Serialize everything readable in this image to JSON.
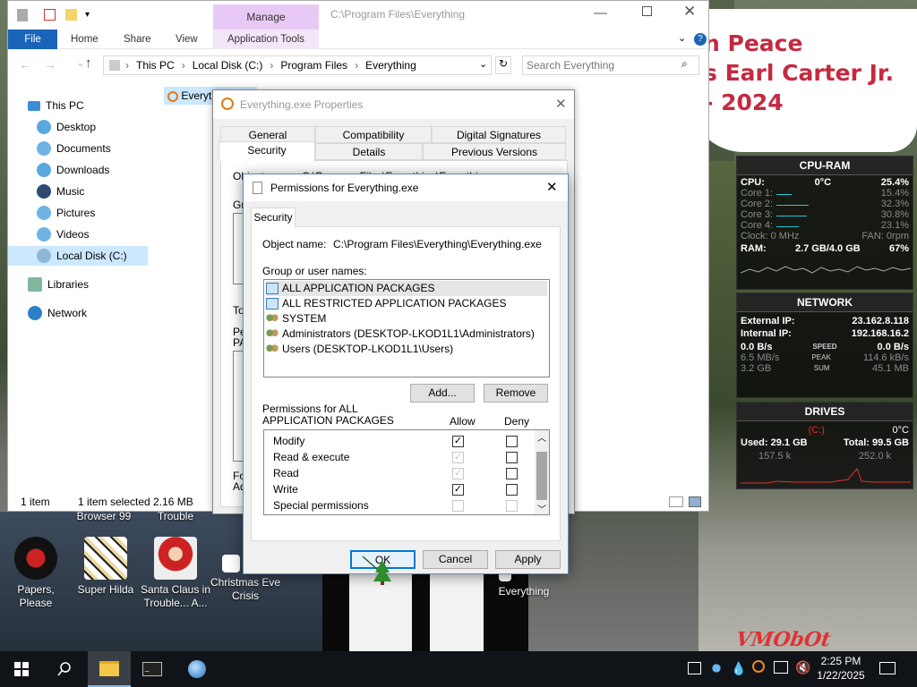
{
  "explorer": {
    "window_title": "C:\\Program Files\\Everything",
    "context_tab": "Manage",
    "tabs": [
      "File",
      "Home",
      "Share",
      "View",
      "Application Tools"
    ],
    "breadcrumb": [
      "This PC",
      "Local Disk (C:)",
      "Program Files",
      "Everything"
    ],
    "search_placeholder": "Search Everything",
    "file_item": "Everything",
    "nav": [
      "This PC",
      "Desktop",
      "Documents",
      "Downloads",
      "Music",
      "Pictures",
      "Videos",
      "Local Disk (C:)",
      "Libraries",
      "Network"
    ],
    "status": {
      "count": "1 item",
      "selected": "1 item selected  2.16 MB"
    }
  },
  "props": {
    "title": "Everything.exe Properties",
    "tabs_row1": [
      "General",
      "Compatibility",
      "Digital Signatures"
    ],
    "tabs_row2": [
      "Security",
      "Details",
      "Previous Versions"
    ],
    "obj_label_partial": "Object name:",
    "obj_value_partial": "C:\\Program Files\\Everything\\Everything.exe",
    "frag_gr": "Gr",
    "frag_to": "To",
    "frag_pe": "Pe",
    "frag_pa": "PA",
    "frag_fo": "Fo",
    "frag_ad": "Ad"
  },
  "perm": {
    "title": "Permissions for Everything.exe",
    "tab": "Security",
    "object_label": "Object name:",
    "object_value": "C:\\Program Files\\Everything\\Everything.exe",
    "group_label": "Group or user names:",
    "groups": [
      "ALL APPLICATION PACKAGES",
      "ALL RESTRICTED APPLICATION PACKAGES",
      "SYSTEM",
      "Administrators (DESKTOP-LKOD1L1\\Administrators)",
      "Users (DESKTOP-LKOD1L1\\Users)"
    ],
    "add_label": "Add...",
    "remove_label": "Remove",
    "permissions_label_1": "Permissions for ALL",
    "permissions_label_2": "APPLICATION PACKAGES",
    "allow_label": "Allow",
    "deny_label": "Deny",
    "permissions": [
      {
        "name": "Modify",
        "allow": "checked",
        "deny": "unchecked"
      },
      {
        "name": "Read & execute",
        "allow": "checked-disabled",
        "deny": "unchecked"
      },
      {
        "name": "Read",
        "allow": "checked-disabled",
        "deny": "unchecked"
      },
      {
        "name": "Write",
        "allow": "checked",
        "deny": "unchecked"
      },
      {
        "name": "Special permissions",
        "allow": "unchecked-disabled",
        "deny": "unchecked-disabled"
      }
    ],
    "ok_label": "OK",
    "cancel_label": "Cancel",
    "apply_label": "Apply"
  },
  "desktop": {
    "banner": [
      "n Peace",
      "s Earl Carter Jr.",
      "- 2024"
    ],
    "icons": [
      "Papers, Please",
      "Super Hilda",
      "Santa Claus in Trouble... A...",
      "Christmas Eve Crisis",
      "Everything"
    ],
    "partial_labels": [
      "Browser 99",
      "Trouble"
    ],
    "watermark": "VMObOt"
  },
  "widgets": {
    "cpu": {
      "title": "CPU-RAM",
      "cpu_label": "CPU:",
      "temp": "0°C",
      "cpu_pct": "25.4%",
      "cores": [
        {
          "label": "Core 1:",
          "value": "15.4%",
          "fill": 0.154
        },
        {
          "label": "Core 2:",
          "value": "32.3%",
          "fill": 0.323
        },
        {
          "label": "Core 3:",
          "value": "30.8%",
          "fill": 0.308
        },
        {
          "label": "Core 4:",
          "value": "23.1%",
          "fill": 0.231
        }
      ],
      "clock": "Clock: 0 MHz",
      "fan": "FAN: 0rpm",
      "ram_label": "RAM:",
      "ram_value": "2.7 GB/4.0 GB",
      "ram_pct": "67%"
    },
    "network": {
      "title": "NETWORK",
      "ext_label": "External IP:",
      "ext_ip": "23.162.8.118",
      "int_label": "Internal IP:",
      "int_ip": "192.168.16.2",
      "rows": [
        {
          "left": "0.0 B/s",
          "mid": "SPEED",
          "right": "0.0 B/s"
        },
        {
          "left": "6.5 MB/s",
          "mid": "PEAK",
          "right": "114.6 kB/s"
        },
        {
          "left": "3.2 GB",
          "mid": "SUM",
          "right": "45.1 MB"
        }
      ]
    },
    "drives": {
      "title": "DRIVES",
      "drive": "(C:)",
      "temp": "0°C",
      "used": "Used: 29.1 GB",
      "total": "Total: 99.5 GB",
      "read": "157.5 k",
      "write": "252.0 k"
    }
  },
  "taskbar": {
    "time": "2:25 PM",
    "date": "1/22/2025"
  },
  "colors": {
    "accent": "#1a64b8",
    "manage": "#e8c9f5",
    "widget_cyan": "#22c9d8",
    "widget_red": "#e03030"
  }
}
